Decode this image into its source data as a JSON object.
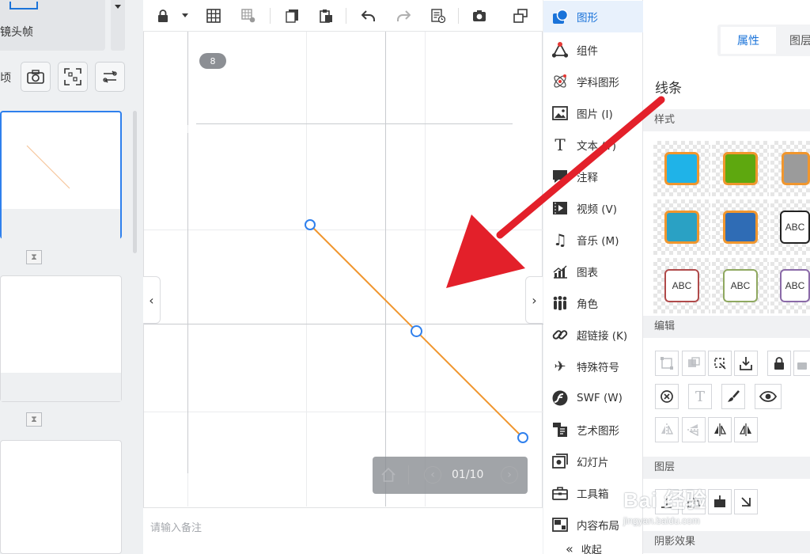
{
  "left_panel": {
    "camera_frame_label": "镜头帧",
    "partial_label": "顷"
  },
  "canvas": {
    "slide_badge": "8",
    "note_placeholder": "请输入备注",
    "page_indicator": "01/10"
  },
  "insert_menu": {
    "items": [
      {
        "label": "图形",
        "icon": "shape-icon",
        "active": true
      },
      {
        "label": "组件",
        "icon": "component-icon"
      },
      {
        "label": "学科图形",
        "icon": "atom-icon"
      },
      {
        "label": "图片 (I)",
        "icon": "image-icon"
      },
      {
        "label": "文本 (T)",
        "icon": "text-icon"
      },
      {
        "label": "注释",
        "icon": "comment-icon"
      },
      {
        "label": "视频 (V)",
        "icon": "video-icon"
      },
      {
        "label": "音乐 (M)",
        "icon": "music-icon"
      },
      {
        "label": "图表",
        "icon": "chart-icon"
      },
      {
        "label": "角色",
        "icon": "people-icon"
      },
      {
        "label": "超链接 (K)",
        "icon": "link-icon"
      },
      {
        "label": "特殊符号",
        "icon": "airplane-icon"
      },
      {
        "label": "SWF (W)",
        "icon": "swf-icon"
      },
      {
        "label": "艺术图形",
        "icon": "art-icon"
      },
      {
        "label": "幻灯片",
        "icon": "slides-icon"
      },
      {
        "label": "工具箱",
        "icon": "toolbox-icon"
      },
      {
        "label": "内容布局",
        "icon": "layout-icon"
      }
    ],
    "collapse_label": "收起"
  },
  "prop_panel": {
    "tabs": [
      "属性",
      "图层"
    ],
    "object_title": "线条",
    "sections": {
      "style": "样式",
      "edit": "编辑",
      "layer": "图层",
      "shadow": "阴影效果"
    },
    "swatches": [
      {
        "fill": "#1fb3e8",
        "border": "#f0962e",
        "text": ""
      },
      {
        "fill": "#5ea80f",
        "border": "#f0962e",
        "text": ""
      },
      {
        "fill": "#9b9b9b",
        "border": "#f0962e",
        "text": ""
      },
      {
        "fill": "#2aa1c4",
        "border": "#f0962e",
        "text": ""
      },
      {
        "fill": "#2f6cb5",
        "border": "#f0962e",
        "text": ""
      },
      {
        "fill": "#ffffff",
        "border": "#222222",
        "text": "ABC"
      },
      {
        "fill": "#ffffff",
        "border": "#b04a4a",
        "text": "ABC"
      },
      {
        "fill": "#ffffff",
        "border": "#8fa860",
        "text": "ABC"
      },
      {
        "fill": "#ffffff",
        "border": "#8a6aa8",
        "text": "ABC"
      }
    ]
  },
  "watermark": {
    "line1": "Bai 经验",
    "line2": "jingyan.baidu.com"
  },
  "colors": {
    "accent": "#1a73d9",
    "line_stroke": "#f0962e",
    "arrow": "#e3202a",
    "handle": "#2f80ed"
  }
}
